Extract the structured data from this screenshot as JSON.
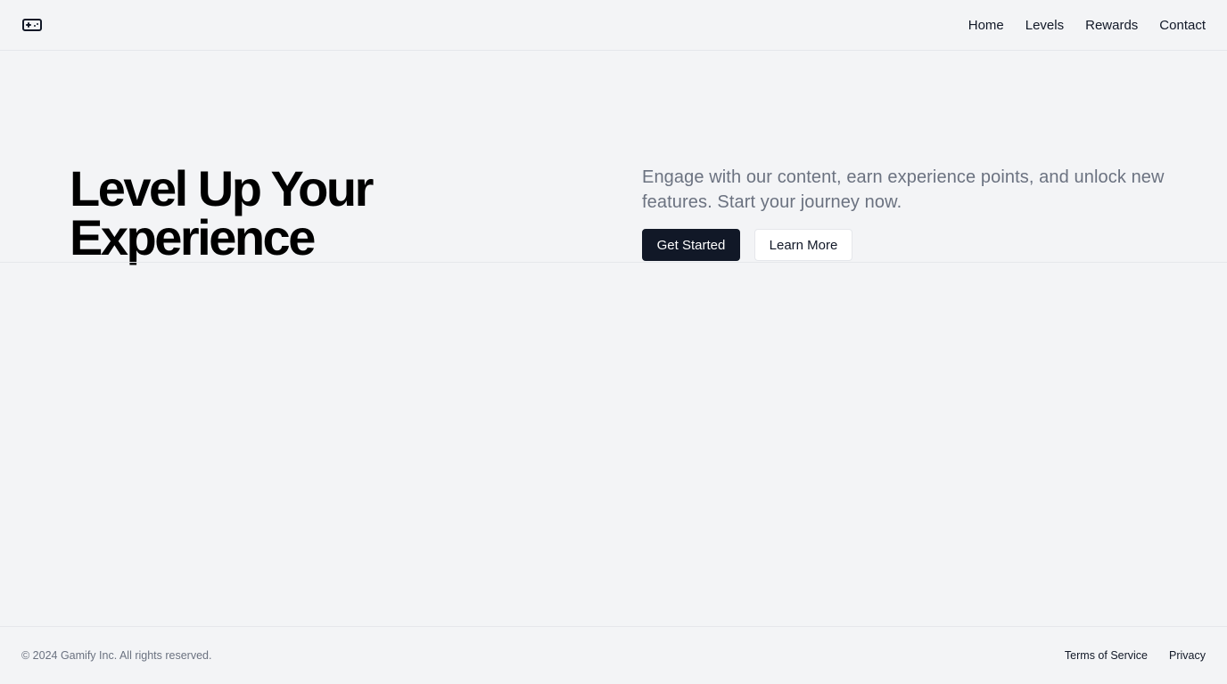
{
  "header": {
    "logo_icon": "gamepad-icon",
    "nav": [
      {
        "label": "Home"
      },
      {
        "label": "Levels"
      },
      {
        "label": "Rewards"
      },
      {
        "label": "Contact"
      }
    ]
  },
  "hero": {
    "title_line1": "Level Up Your",
    "title_line2": "Experience",
    "description": "Engage with our content, earn experience points, and unlock new features. Start your journey now.",
    "primary_button": "Get Started",
    "secondary_button": "Learn More"
  },
  "footer": {
    "copyright": "© 2024 Gamify Inc. All rights reserved.",
    "links": [
      {
        "label": "Terms of Service"
      },
      {
        "label": "Privacy"
      }
    ]
  },
  "colors": {
    "background": "#f3f4f6",
    "primary": "#111827",
    "muted_text": "#6b7280",
    "border": "#e5e7eb"
  }
}
